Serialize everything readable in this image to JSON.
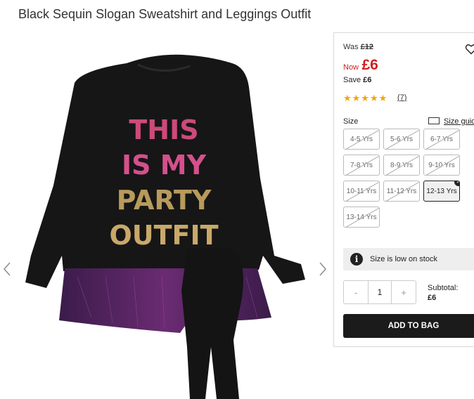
{
  "product": {
    "title": "Black Sequin Slogan Sweatshirt and Leggings Outfit",
    "image_text": [
      "THIS",
      "IS MY",
      "PARTY",
      "OUTFIT"
    ]
  },
  "pricing": {
    "was_label": "Was",
    "was_price": "£12",
    "now_label": "Now",
    "now_price": "£6",
    "save_label": "Save",
    "save_amount": "£6"
  },
  "rating": {
    "stars": 5,
    "review_count": "(7)"
  },
  "size": {
    "label": "Size",
    "guide_label": "Size guide",
    "options": [
      {
        "label": "4-5 Yrs",
        "available": false
      },
      {
        "label": "5-6 Yrs",
        "available": false
      },
      {
        "label": "6-7 Yrs",
        "available": false
      },
      {
        "label": "7-8 Yrs",
        "available": false
      },
      {
        "label": "8-9 Yrs",
        "available": false
      },
      {
        "label": "9-10 Yrs",
        "available": false
      },
      {
        "label": "10-11 Yrs",
        "available": false
      },
      {
        "label": "11-12 Yrs",
        "available": false
      },
      {
        "label": "12-13 Yrs",
        "available": true,
        "selected": true
      },
      {
        "label": "13-14 Yrs",
        "available": false
      }
    ]
  },
  "stock": {
    "message": "Size is low on stock"
  },
  "quantity": {
    "minus": "-",
    "value": "1",
    "plus": "+"
  },
  "subtotal": {
    "label": "Subtotal:",
    "value": "£6"
  },
  "actions": {
    "add_to_bag": "ADD TO BAG"
  },
  "colors": {
    "price_red": "#d11f1f",
    "star": "#f2a413",
    "button": "#1b1b1b"
  }
}
